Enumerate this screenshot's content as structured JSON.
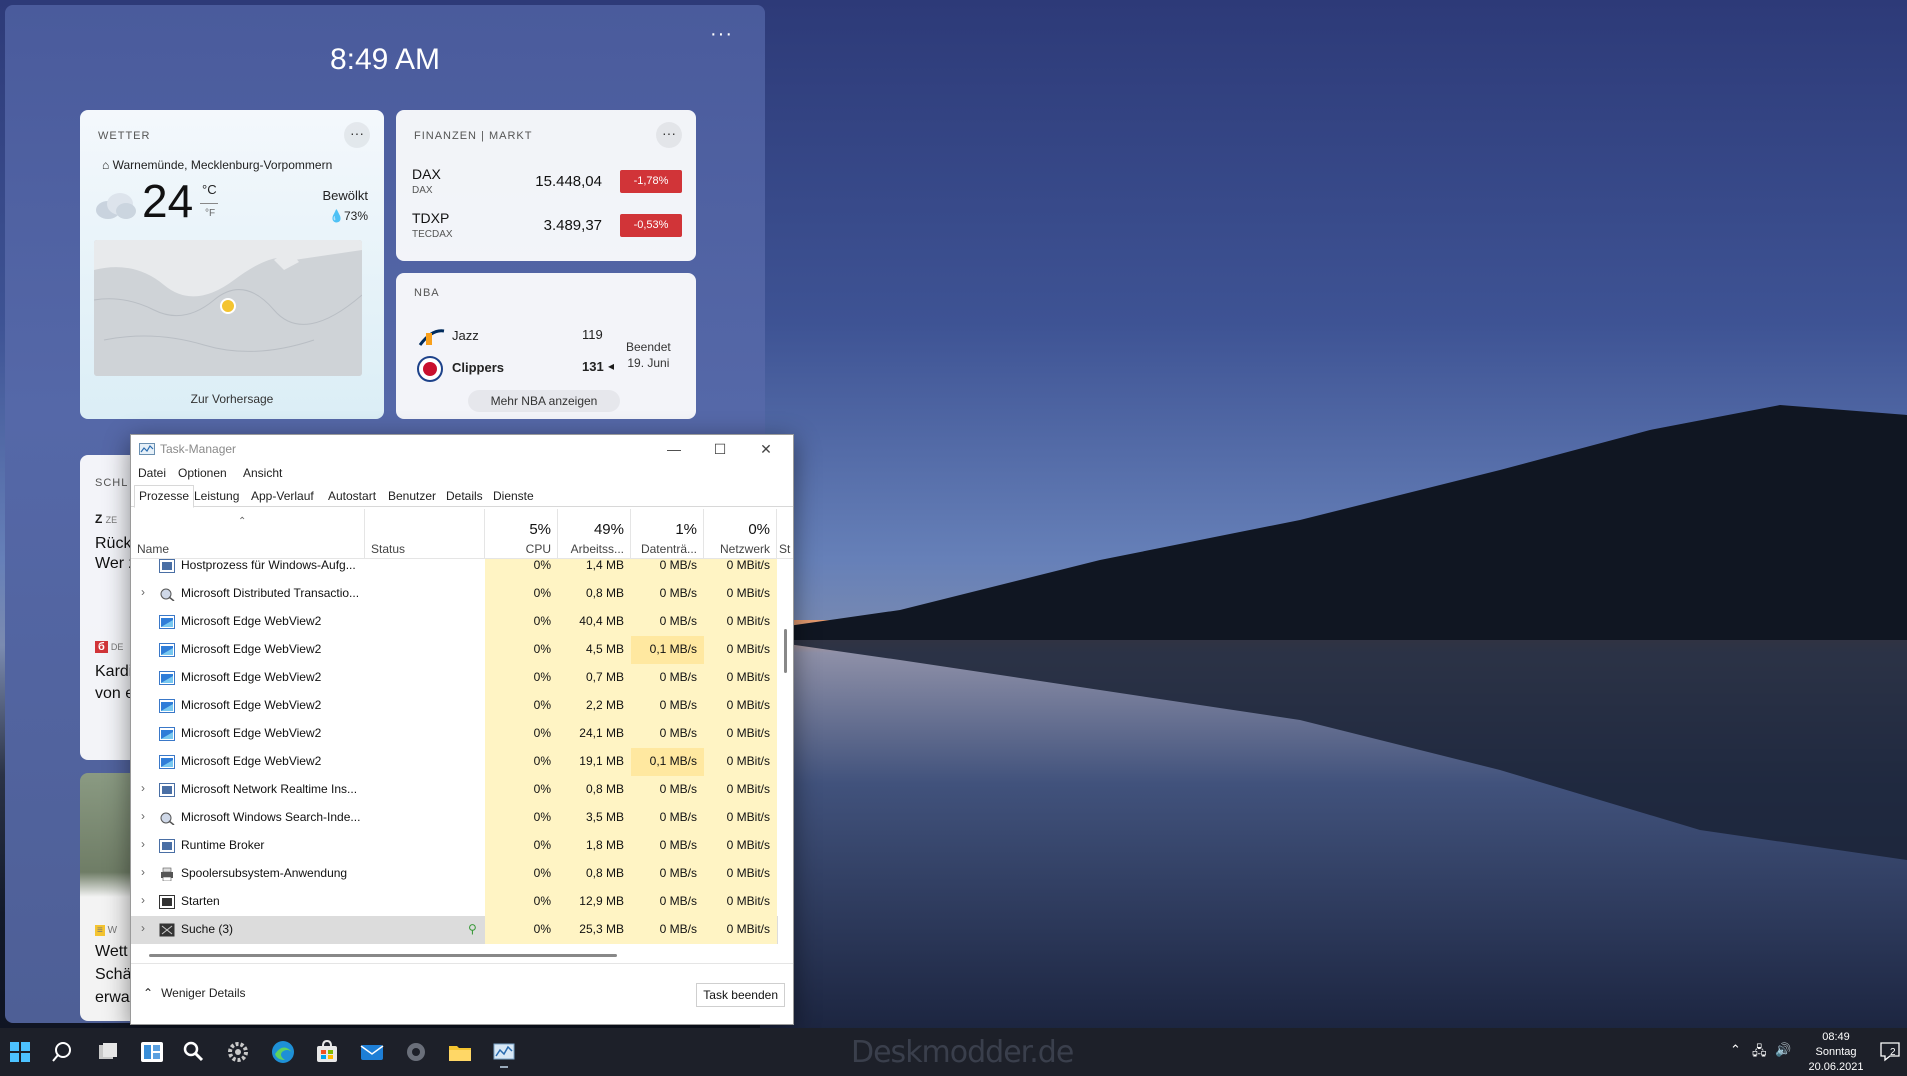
{
  "widgets": {
    "time": "8:49 AM",
    "more": "···",
    "weather": {
      "title": "WETTER",
      "location": "Warnemünde, Mecklenburg-Vorpommern",
      "temperature": "24",
      "unit_c": "°C",
      "unit_f": "°F",
      "condition": "Bewölkt",
      "humidity": "73%",
      "link": "Zur Vorhersage"
    },
    "finance": {
      "title": "FINANZEN | MARKT",
      "stocks": [
        {
          "symbol": "DAX",
          "name": "DAX",
          "value": "15.448,04",
          "change": "-1,78%"
        },
        {
          "symbol": "TDXP",
          "name": "TECDAX",
          "value": "3.489,37",
          "change": "-0,53%"
        }
      ]
    },
    "nba": {
      "title": "NBA",
      "teams": [
        {
          "name": "Jazz",
          "score": "119"
        },
        {
          "name": "Clippers",
          "score": "131"
        }
      ],
      "status_line1": "Beendet",
      "status_line2": "19. Juni",
      "more": "Mehr NBA anzeigen"
    },
    "news": {
      "title": "SCHL",
      "item1_source": "ZE",
      "item1_line1": "Rück",
      "item1_line2": "Wer z",
      "item2_source": "DE",
      "item2_line1": "Kardi",
      "item2_line2": "von e",
      "item3_source": "W",
      "item3_line1": "Wett",
      "item3_line2": "Schä",
      "item3_line3": "erwa"
    }
  },
  "taskmanager": {
    "title": "Task-Manager",
    "menu": [
      "Datei",
      "Optionen",
      "Ansicht"
    ],
    "tabs": [
      "Prozesse",
      "Leistung",
      "App-Verlauf",
      "Autostart",
      "Benutzer",
      "Details",
      "Dienste"
    ],
    "columns": {
      "name": "Name",
      "status": "Status",
      "cpu_pct": "5%",
      "cpu": "CPU",
      "mem_pct": "49%",
      "mem": "Arbeitss...",
      "disk_pct": "1%",
      "disk": "Datenträ...",
      "net_pct": "0%",
      "net": "Netzwerk",
      "extra": "St"
    },
    "rows": [
      {
        "name": "Hostprozess für Windows-Aufg...",
        "cpu": "0%",
        "mem": "1,4 MB",
        "disk": "0 MB/s",
        "net": "0 MBit/s",
        "expand": ""
      },
      {
        "name": "Microsoft Distributed Transactio...",
        "cpu": "0%",
        "mem": "0,8 MB",
        "disk": "0 MB/s",
        "net": "0 MBit/s",
        "expand": "›"
      },
      {
        "name": "Microsoft Edge WebView2",
        "cpu": "0%",
        "mem": "40,4 MB",
        "disk": "0 MB/s",
        "net": "0 MBit/s",
        "expand": ""
      },
      {
        "name": "Microsoft Edge WebView2",
        "cpu": "0%",
        "mem": "4,5 MB",
        "disk": "0,1 MB/s",
        "net": "0 MBit/s",
        "expand": ""
      },
      {
        "name": "Microsoft Edge WebView2",
        "cpu": "0%",
        "mem": "0,7 MB",
        "disk": "0 MB/s",
        "net": "0 MBit/s",
        "expand": ""
      },
      {
        "name": "Microsoft Edge WebView2",
        "cpu": "0%",
        "mem": "2,2 MB",
        "disk": "0 MB/s",
        "net": "0 MBit/s",
        "expand": ""
      },
      {
        "name": "Microsoft Edge WebView2",
        "cpu": "0%",
        "mem": "24,1 MB",
        "disk": "0 MB/s",
        "net": "0 MBit/s",
        "expand": ""
      },
      {
        "name": "Microsoft Edge WebView2",
        "cpu": "0%",
        "mem": "19,1 MB",
        "disk": "0,1 MB/s",
        "net": "0 MBit/s",
        "expand": ""
      },
      {
        "name": "Microsoft Network Realtime Ins...",
        "cpu": "0%",
        "mem": "0,8 MB",
        "disk": "0 MB/s",
        "net": "0 MBit/s",
        "expand": "›"
      },
      {
        "name": "Microsoft Windows Search-Inde...",
        "cpu": "0%",
        "mem": "3,5 MB",
        "disk": "0 MB/s",
        "net": "0 MBit/s",
        "expand": "›"
      },
      {
        "name": "Runtime Broker",
        "cpu": "0%",
        "mem": "1,8 MB",
        "disk": "0 MB/s",
        "net": "0 MBit/s",
        "expand": "›"
      },
      {
        "name": "Spoolersubsystem-Anwendung",
        "cpu": "0%",
        "mem": "0,8 MB",
        "disk": "0 MB/s",
        "net": "0 MBit/s",
        "expand": "›"
      },
      {
        "name": "Starten",
        "cpu": "0%",
        "mem": "12,9 MB",
        "disk": "0 MB/s",
        "net": "0 MBit/s",
        "expand": "›"
      },
      {
        "name": "Suche (3)",
        "cpu": "0%",
        "mem": "25,3 MB",
        "disk": "0 MB/s",
        "net": "0 MBit/s",
        "expand": "›"
      }
    ],
    "less_details": "Weniger Details",
    "end_task": "Task beenden"
  },
  "taskbar": {
    "watermark": "Deskmodder.de",
    "time": "08:49",
    "day": "Sonntag",
    "date": "20.06.2021",
    "notification_count": "2"
  },
  "colors": {
    "accent": "#0078d4",
    "negative": "#d13438",
    "cpu_highlight": "#fff4c4"
  }
}
